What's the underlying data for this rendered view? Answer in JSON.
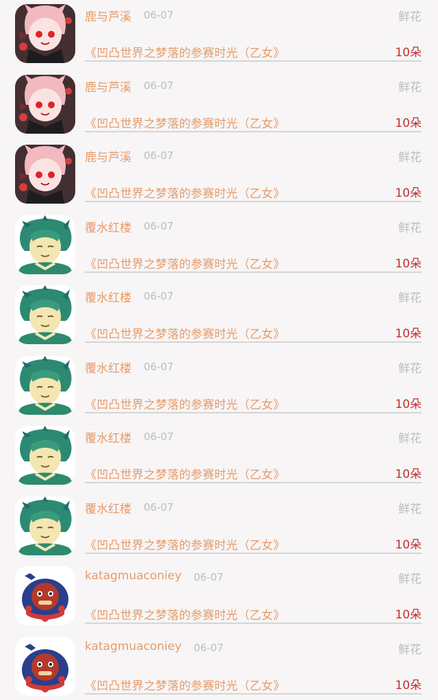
{
  "rows": [
    {
      "user": "鹿与芦溪",
      "date": "06-07",
      "gift": "鲜花",
      "book": "《凹凸世界之梦落的参赛时光（乙女》",
      "count": "10朵",
      "avatar": "anime-girl-avatar"
    },
    {
      "user": "鹿与芦溪",
      "date": "06-07",
      "gift": "鲜花",
      "book": "《凹凸世界之梦落的参赛时光（乙女》",
      "count": "10朵",
      "avatar": "anime-girl-avatar"
    },
    {
      "user": "鹿与芦溪",
      "date": "06-07",
      "gift": "鲜花",
      "book": "《凹凸世界之梦落的参赛时光（乙女》",
      "count": "10朵",
      "avatar": "anime-girl-avatar"
    },
    {
      "user": "覆水红楼",
      "date": "06-07",
      "gift": "鲜花",
      "book": "《凹凸世界之梦落的参赛时光（乙女》",
      "count": "10朵",
      "avatar": "green-hair-boy-avatar"
    },
    {
      "user": "覆水红楼",
      "date": "06-07",
      "gift": "鲜花",
      "book": "《凹凸世界之梦落的参赛时光（乙女》",
      "count": "10朵",
      "avatar": "green-hair-boy-avatar"
    },
    {
      "user": "覆水红楼",
      "date": "06-07",
      "gift": "鲜花",
      "book": "《凹凸世界之梦落的参赛时光（乙女》",
      "count": "10朵",
      "avatar": "green-hair-boy-avatar"
    },
    {
      "user": "覆水红楼",
      "date": "06-07",
      "gift": "鲜花",
      "book": "《凹凸世界之梦落的参赛时光（乙女》",
      "count": "10朵",
      "avatar": "green-hair-boy-avatar"
    },
    {
      "user": "覆水红楼",
      "date": "06-07",
      "gift": "鲜花",
      "book": "《凹凸世界之梦落的参赛时光（乙女》",
      "count": "10朵",
      "avatar": "green-hair-boy-avatar"
    },
    {
      "user": "katagmuaconiey",
      "date": "06-07",
      "gift": "鲜花",
      "book": "《凹凸世界之梦落的参赛时光（乙女》",
      "count": "10朵",
      "avatar": "cartoon-mascot-avatar"
    },
    {
      "user": "katagmuaconiey",
      "date": "06-07",
      "gift": "鲜花",
      "book": "《凹凸世界之梦落的参赛时光（乙女》",
      "count": "10朵",
      "avatar": "cartoon-mascot-avatar"
    }
  ],
  "colors": {
    "background": "#f7f5f6",
    "name": "#e69c6b",
    "muted": "#bdbdbd",
    "count": "#c0312f",
    "divider": "#d5d5d5"
  }
}
